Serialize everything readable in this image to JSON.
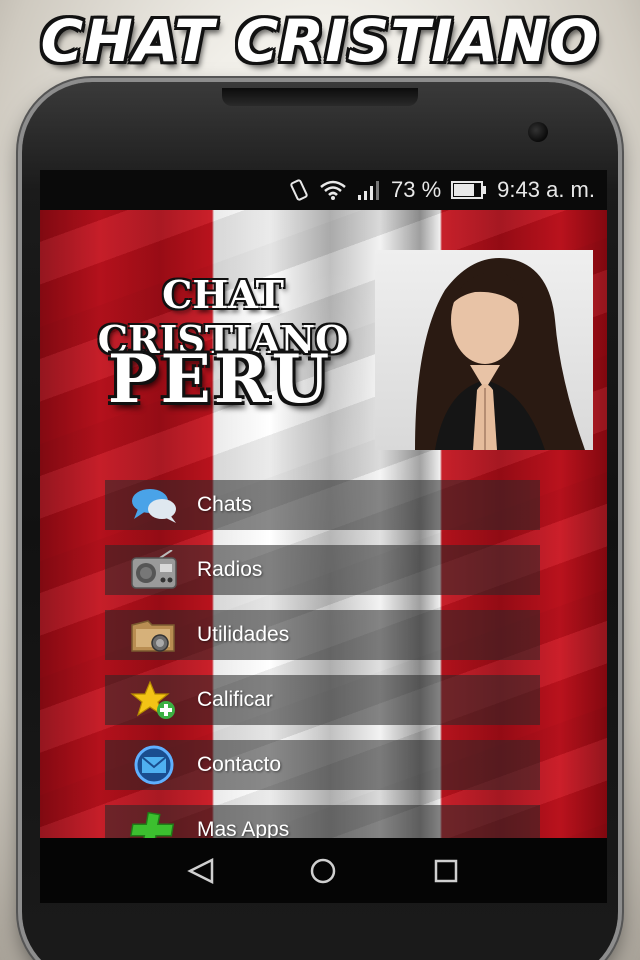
{
  "promo": {
    "title": "CHAT CRISTIANO PERU"
  },
  "status_bar": {
    "battery_percent": "73 %",
    "time": "9:43 a. m.",
    "icons": [
      "vibrate-icon",
      "wifi-icon",
      "signal-icon",
      "battery-icon"
    ]
  },
  "header": {
    "title_line1": "CHAT CRISTIANO",
    "title_line2": "PERU"
  },
  "menu": {
    "items": [
      {
        "label": "Chats",
        "icon": "chat-bubbles-icon"
      },
      {
        "label": "Radios",
        "icon": "radio-icon"
      },
      {
        "label": "Utilidades",
        "icon": "tools-icon"
      },
      {
        "label": "Calificar",
        "icon": "star-icon"
      },
      {
        "label": "Contacto",
        "icon": "mail-icon"
      },
      {
        "label": "Mas Apps",
        "icon": "plus-icon"
      }
    ]
  },
  "nav_bar": {
    "icons": [
      "back-icon",
      "home-icon",
      "recents-icon"
    ]
  },
  "colors": {
    "flag_red": "#c3121e",
    "flag_white": "#ffffff",
    "menu_bg": "#282828"
  }
}
